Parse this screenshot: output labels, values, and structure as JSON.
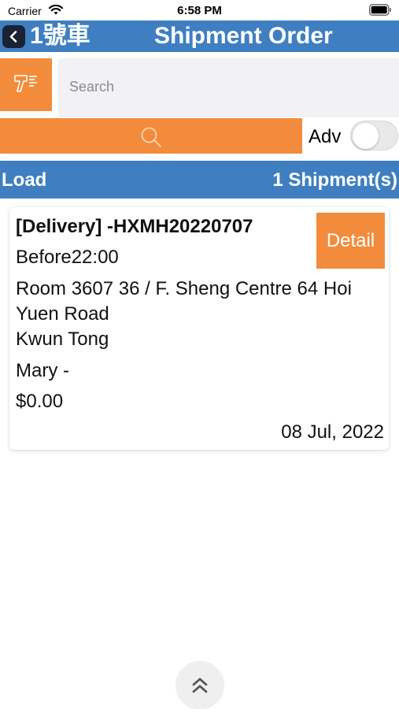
{
  "status_bar": {
    "carrier": "Carrier",
    "time": "6:58 PM",
    "wifi_icon": "wifi-icon",
    "battery_icon": "battery-icon"
  },
  "nav": {
    "back_icon": "chevron-left-icon",
    "truck": "1號車",
    "title": "Shipment Order"
  },
  "search": {
    "scan_icon": "barcode-scanner-icon",
    "placeholder": "Search",
    "value": "",
    "search_icon": "magnifier-icon",
    "adv_label": "Adv",
    "adv_enabled": false
  },
  "load_bar": {
    "label": "Load",
    "count": "1 Shipment(s)"
  },
  "shipments": [
    {
      "title": "[Delivery] -HXMH20220707",
      "deadline": "Before22:00",
      "address_line1": "Room 3607 36 / F. Sheng Centre 64 Hoi",
      "address_line2": "Yuen Road",
      "district": "Kwun Tong",
      "contact": "Mary -",
      "amount": "$0.00",
      "date": "08 Jul, 2022",
      "detail_label": "Detail"
    }
  ],
  "scroll_top_icon": "double-chevron-up-icon",
  "colors": {
    "nav_blue": "#3f7fc1",
    "accent_orange": "#f28c3c",
    "search_bg": "#f2f2f4",
    "back_button": "#1a2233"
  }
}
